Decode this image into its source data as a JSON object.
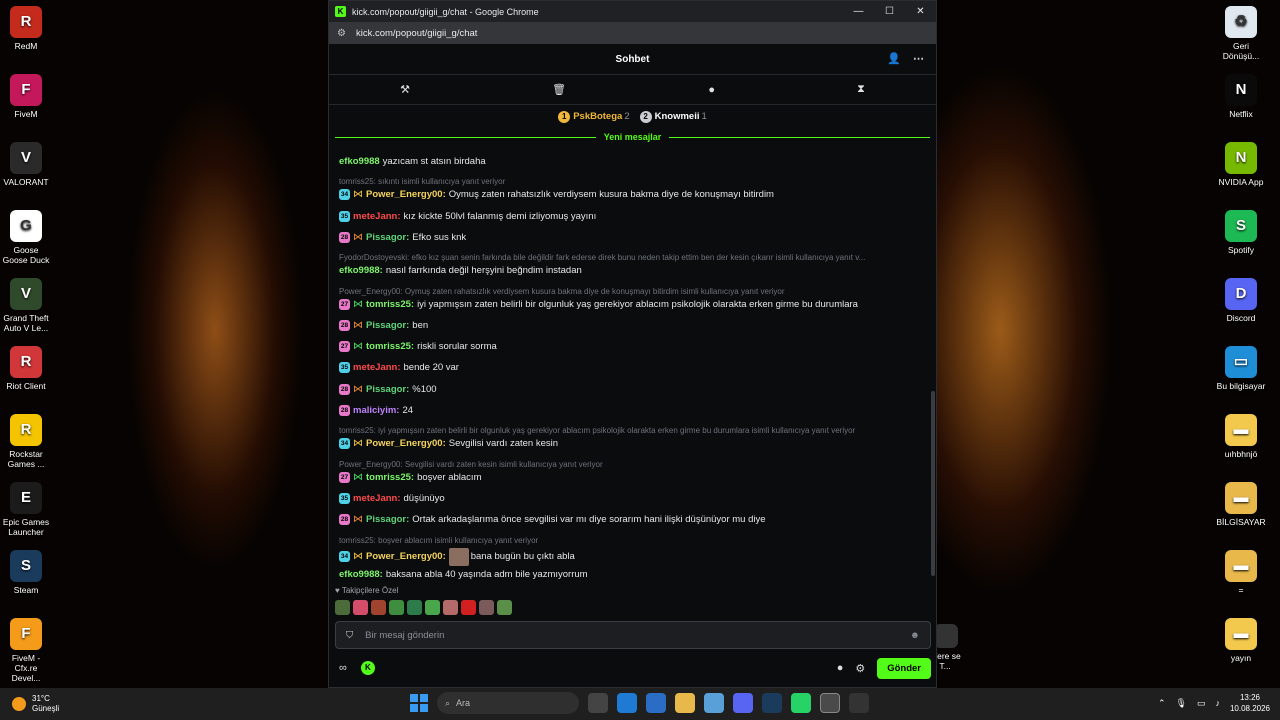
{
  "desktop": {
    "left_icons": [
      {
        "label": "RedM",
        "color": "#c42b1c",
        "glyph": "R"
      },
      {
        "label": "FiveM",
        "color": "#c3185a",
        "glyph": "F"
      },
      {
        "label": "VALORANT",
        "color": "#2a2a2a",
        "glyph": "V"
      },
      {
        "label": "Goose Goose Duck",
        "color": "#ffffff",
        "glyph": "G"
      },
      {
        "label": "Grand Theft Auto V Le...",
        "color": "#2f4a2a",
        "glyph": "V"
      },
      {
        "label": "Riot Client",
        "color": "#d13639",
        "glyph": "R"
      },
      {
        "label": "Rockstar Games ...",
        "color": "#f5c400",
        "glyph": "R"
      },
      {
        "label": "Epic Games Launcher",
        "color": "#1b1b1b",
        "glyph": "E"
      },
      {
        "label": "Steam",
        "color": "#1a3b5c",
        "glyph": "S"
      },
      {
        "label": "FiveM - Cfx.re Devel...",
        "color": "#f49b1a",
        "glyph": "F"
      }
    ],
    "right_icons": [
      {
        "label": "Geri Dönüşü...",
        "color": "#dfe7ef",
        "glyph": "♻"
      },
      {
        "label": "Netflix",
        "color": "#0a0a0a",
        "glyph": "N"
      },
      {
        "label": "NVIDIA App",
        "color": "#76b900",
        "glyph": "N"
      },
      {
        "label": "Spotify",
        "color": "#1db954",
        "glyph": "S"
      },
      {
        "label": "Discord",
        "color": "#5865f2",
        "glyph": "D"
      },
      {
        "label": "Bu bilgisayar",
        "color": "#1e8fd6",
        "glyph": "▭"
      },
      {
        "label": "uıhbhnjö",
        "color": "#f2c94c",
        "glyph": "▬"
      },
      {
        "label": "BİLGİSAYAR",
        "color": "#e8b84a",
        "glyph": "▬"
      },
      {
        "label": "=",
        "color": "#e8b84a",
        "glyph": "▬"
      },
      {
        "label": "yayın",
        "color": "#f2c94c",
        "glyph": "▬"
      }
    ],
    "partial_icon_label": "Were se T..."
  },
  "window": {
    "title": "kick.com/popout/giigii_g/chat - Google Chrome",
    "url": "kick.com/popout/giigii_g/chat"
  },
  "chat": {
    "header_title": "Sohbet",
    "leaders": [
      {
        "rank": "1",
        "name": "PskBotega",
        "count": "2",
        "color": "#f0b83a"
      },
      {
        "rank": "2",
        "name": "Knowmeii",
        "count": "1",
        "color": "#c9ccd1"
      }
    ],
    "new_messages_label": "Yeni mesajlar",
    "items": [
      {
        "type": "msg",
        "badge": "",
        "fly": false,
        "user": "efko9988",
        "color": "#7cf56a",
        "text": "yazıcam st atsın birdaha"
      },
      {
        "type": "reply",
        "text": "tomriss25: sıkıntı isimli kullanıcıya yanıt veriyor"
      },
      {
        "type": "msg",
        "badge": "34",
        "badgeColor": "#4fd1e8",
        "fly": "gold",
        "user": "Power_Energy00:",
        "color": "#f4d35e",
        "text": "Oymuş zaten rahatsızlık verdiysem kusura bakma diye de konuşmayı bitirdim"
      },
      {
        "type": "msg",
        "badge": "35",
        "badgeColor": "#4fd1e8",
        "fly": false,
        "user": "meteJann:",
        "color": "#ff4a4a",
        "text": "kız kickte 50lvl falanmış demi izliyomuş yayını"
      },
      {
        "type": "msg",
        "badge": "28",
        "badgeColor": "#e879c8",
        "fly": "orange",
        "user": "Pissagor:",
        "color": "#5fd37a",
        "text": "Efko sus knk"
      },
      {
        "type": "reply",
        "text": "FyodorDostoyevski: efko kız şuan senin farkında bile değildir fark ederse direk bunu neden takip ettim ben der kesin çıkarır isimli kullanıcıya yanıt v..."
      },
      {
        "type": "msg",
        "badge": "",
        "fly": false,
        "user": "efko9988:",
        "color": "#7cf56a",
        "text": "nasıl farrkında değil herşyini beğndim instadan"
      },
      {
        "type": "reply",
        "text": "Power_Energy00: Oymuş zaten rahatsızlık verdiysem kusura bakma diye de konuşmayı bitirdim isimli kullanıcıya yanıt veriyor"
      },
      {
        "type": "msg",
        "badge": "27",
        "badgeColor": "#e879c8",
        "fly": "green",
        "user": "tomriss25:",
        "color": "#7cf56a",
        "text": "iyi yapmışsın zaten belirli bir olgunluk yaş gerekiyor ablacım psikolojik olarakta erken girme bu durumlara"
      },
      {
        "type": "msg",
        "badge": "28",
        "badgeColor": "#e879c8",
        "fly": "orange",
        "user": "Pissagor:",
        "color": "#5fd37a",
        "text": "ben"
      },
      {
        "type": "msg",
        "badge": "27",
        "badgeColor": "#e879c8",
        "fly": "green",
        "user": "tomriss25:",
        "color": "#7cf56a",
        "text": "riskli sorular sorma"
      },
      {
        "type": "msg",
        "badge": "35",
        "badgeColor": "#4fd1e8",
        "fly": false,
        "user": "meteJann:",
        "color": "#ff4a4a",
        "text": "bende 20 var"
      },
      {
        "type": "msg",
        "badge": "28",
        "badgeColor": "#e879c8",
        "fly": "orange",
        "user": "Pissagor:",
        "color": "#5fd37a",
        "text": "%100"
      },
      {
        "type": "msg",
        "badge": "28",
        "badgeColor": "#e879c8",
        "fly": false,
        "user": "maliciyim:",
        "color": "#c084fc",
        "text": "24"
      },
      {
        "type": "reply",
        "text": "tomriss25: iyi yapmışsın zaten belirli bir olgunluk yaş gerekiyor ablacım psikolojik olarakta erken girme bu durumlara isimli kullanıcıya yanıt veriyor"
      },
      {
        "type": "msg",
        "badge": "34",
        "badgeColor": "#4fd1e8",
        "fly": "gold",
        "user": "Power_Energy00:",
        "color": "#f4d35e",
        "text": "Sevgilisi vardı zaten kesin"
      },
      {
        "type": "reply",
        "text": "Power_Energy00: Sevgilisi vardı zaten kesin isimli kullanıcıya yanıt veriyor"
      },
      {
        "type": "msg",
        "badge": "27",
        "badgeColor": "#e879c8",
        "fly": "green",
        "user": "tomriss25:",
        "color": "#7cf56a",
        "text": "boşver ablacım"
      },
      {
        "type": "msg",
        "badge": "35",
        "badgeColor": "#4fd1e8",
        "fly": false,
        "user": "meteJann:",
        "color": "#ff4a4a",
        "text": "düşünüyo"
      },
      {
        "type": "msg",
        "badge": "28",
        "badgeColor": "#e879c8",
        "fly": "orange",
        "user": "Pissagor:",
        "color": "#5fd37a",
        "text": "Ortak arkadaşlarıma önce sevgilisi var mı diye sorarım hani ilişki düşünüyor mu diye"
      },
      {
        "type": "reply",
        "text": "tomriss25: boşver ablacım isimli kullanıcıya yanıt veriyor"
      },
      {
        "type": "msg",
        "badge": "34",
        "badgeColor": "#4fd1e8",
        "fly": "gold",
        "user": "Power_Energy00:",
        "color": "#f4d35e",
        "text": "bana bugün bu çıktı abla",
        "emote": true
      },
      {
        "type": "msg",
        "badge": "",
        "fly": false,
        "user": "efko9988:",
        "color": "#7cf56a",
        "text": "baksana abla 40 yaşında adm bile yazmıyorrum"
      }
    ],
    "followers_label": "♥ Takipçilere Özel",
    "input_placeholder": "Bir mesaj gönderin",
    "send_label": "Gönder"
  },
  "taskbar": {
    "weather_temp": "31°C",
    "weather_desc": "Güneşli",
    "search_label": "Ara",
    "time": "13:26",
    "date": "10.08.2026"
  }
}
